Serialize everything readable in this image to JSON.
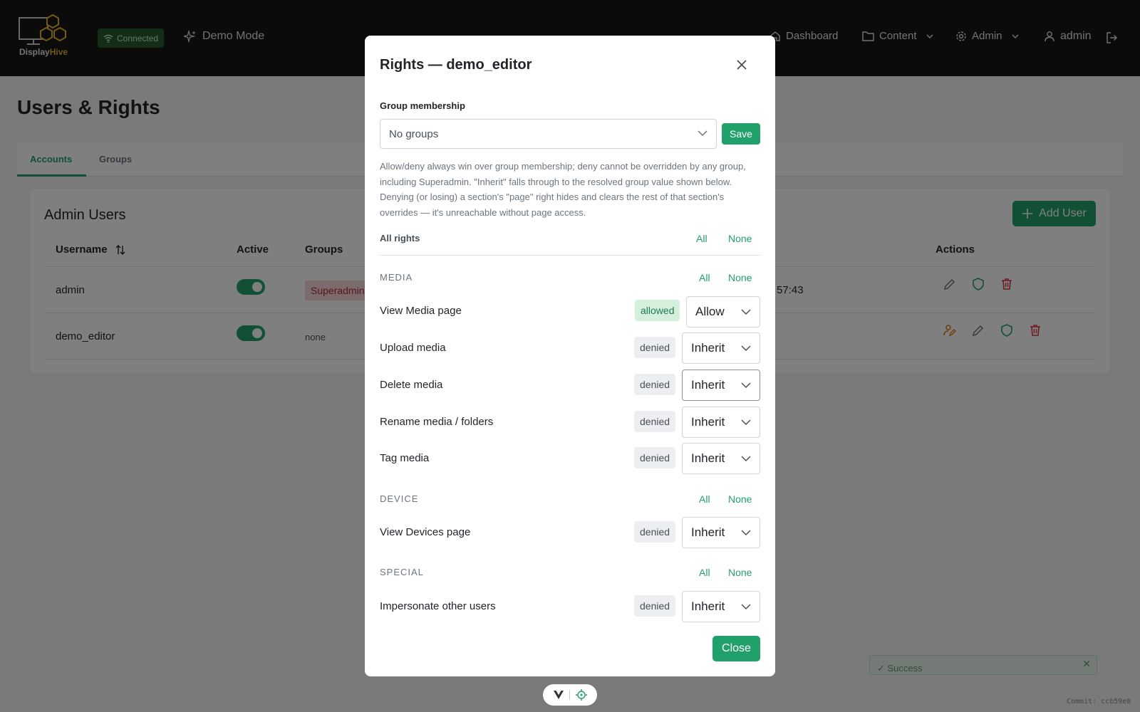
{
  "navbar": {
    "logo_text_a": "Display",
    "logo_text_b": "Hive",
    "connection_status": "Connected",
    "demo_mode_label": "Demo Mode",
    "dashboard_label": "Dashboard",
    "content_label": "Content",
    "admin_menu_label": "Admin",
    "user_label": "admin",
    "icons": [
      "wifi-icon",
      "sparkle-icon",
      "home-icon",
      "folder-icon",
      "gear-icon",
      "user-icon",
      "logout-icon"
    ]
  },
  "page": {
    "title": "Users & Rights",
    "tabs": [
      {
        "label": "Accounts",
        "active": true
      },
      {
        "label": "Groups",
        "active": false
      }
    ],
    "card_title": "Admin Users",
    "add_user_label": "Add User",
    "columns": {
      "username": "Username",
      "active": "Active",
      "groups": "Groups",
      "actions": "Actions"
    },
    "rows": [
      {
        "username": "admin",
        "active": true,
        "groups": "Superadmin",
        "last_seen_partial": "57:43"
      },
      {
        "username": "demo_editor",
        "active": true,
        "groups": "none",
        "last_seen_partial": ""
      }
    ],
    "toast_text": "✓ Success",
    "commit": "Commit: ccb59e0"
  },
  "modal": {
    "title": "Rights — demo_editor",
    "group_membership_label": "Group membership",
    "group_select_value": "No groups",
    "save_label": "Save",
    "help_text": "Allow/deny always win over group membership; deny cannot be overridden by any group, including Superadmin. \"Inherit\" falls through to the resolved group value shown below. Denying (or losing) a section's \"page\" right hides and clears the rest of that section's overrides — it's unreachable without page access.",
    "all_rights_label": "All rights",
    "all_label": "All",
    "none_label": "None",
    "sections": [
      {
        "title": "MEDIA",
        "rights": [
          {
            "label": "View Media page",
            "state": "allowed",
            "value": "Allow"
          },
          {
            "label": "Upload media",
            "state": "denied",
            "value": "Inherit"
          },
          {
            "label": "Delete media",
            "state": "denied",
            "value": "Inherit"
          },
          {
            "label": "Rename media / folders",
            "state": "denied",
            "value": "Inherit"
          },
          {
            "label": "Tag media",
            "state": "denied",
            "value": "Inherit"
          }
        ]
      },
      {
        "title": "DEVICE",
        "rights": [
          {
            "label": "View Devices page",
            "state": "denied",
            "value": "Inherit"
          }
        ]
      },
      {
        "title": "SPECIAL",
        "rights": [
          {
            "label": "Impersonate other users",
            "state": "denied",
            "value": "Inherit"
          }
        ]
      }
    ],
    "close_label": "Close"
  },
  "colors": {
    "accent": "#22a06b",
    "navbar": "#161616",
    "danger": "#dc3545",
    "superadmin_badge": "#f8d7da"
  }
}
